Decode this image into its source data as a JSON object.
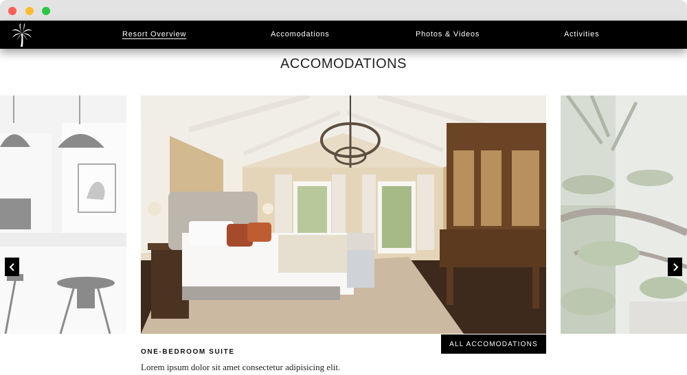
{
  "nav": {
    "items": [
      {
        "label": "Resort Overview",
        "active": true
      },
      {
        "label": "Accomodations",
        "active": false
      },
      {
        "label": "Photos & Videos",
        "active": false
      },
      {
        "label": "Activities",
        "active": false
      }
    ]
  },
  "section": {
    "title": "ACCOMODATIONS"
  },
  "slider": {
    "slides": [
      "kitchen-photo",
      "bedroom-photo",
      "garden-photo"
    ],
    "current": {
      "name": "ONE-BEDROOM SUITE",
      "description": "Lorem ipsum dolor sit amet consectetur adipisicing elit."
    },
    "all_label": "ALL ACCOMODATIONS",
    "prev_icon": "chevron-left-icon",
    "next_icon": "chevron-right-icon"
  },
  "colors": {
    "navbar": "#000000",
    "button": "#000000",
    "chrome": "#e3e3e3"
  }
}
